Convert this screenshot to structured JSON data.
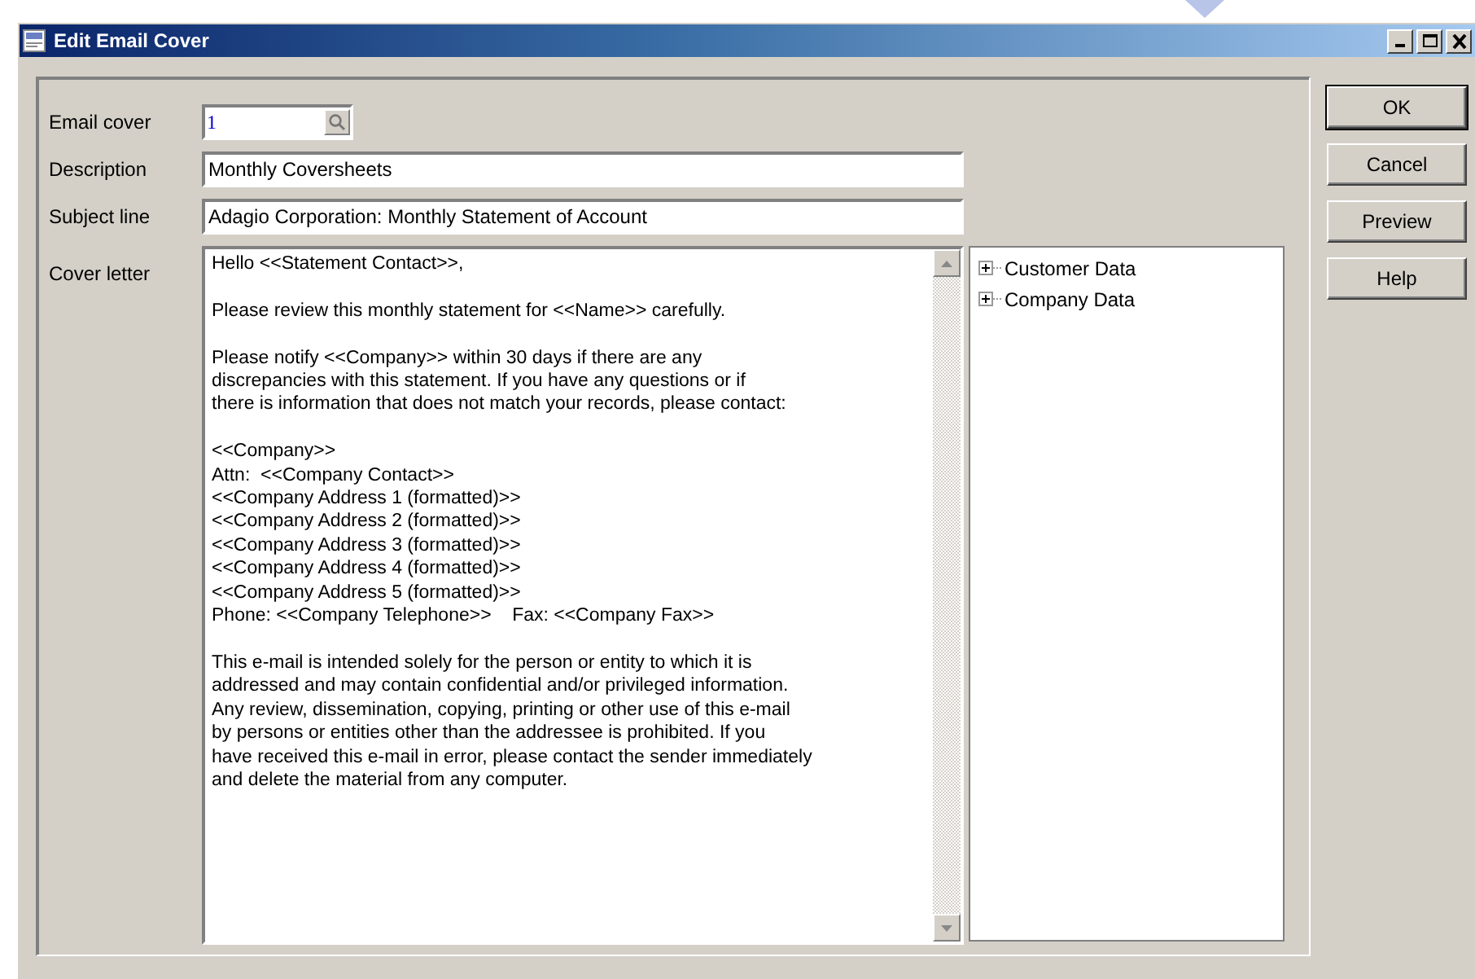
{
  "window": {
    "title": "Edit Email Cover"
  },
  "fields": [
    {
      "label": "Email cover",
      "value": "1",
      "kind": "lookup"
    },
    {
      "label": "Description",
      "value": "Monthly Coversheets",
      "kind": "text"
    },
    {
      "label": "Subject line",
      "value": "Adagio Corporation: Monthly Statement of Account",
      "kind": "text"
    }
  ],
  "cover_letter": {
    "label": "Cover letter",
    "value": "Hello <<Statement Contact>>,\n\nPlease review this monthly statement for <<Name>> carefully.\n\nPlease notify <<Company>> within 30 days if there are any\ndiscrepancies with this statement. If you have any questions or if\nthere is information that does not match your records, please contact:\n\n<<Company>>\nAttn:  <<Company Contact>>\n<<Company Address 1 (formatted)>>\n<<Company Address 2 (formatted)>>\n<<Company Address 3 (formatted)>>\n<<Company Address 4 (formatted)>>\n<<Company Address 5 (formatted)>>\nPhone: <<Company Telephone>>    Fax: <<Company Fax>>\n\nThis e-mail is intended solely for the person or entity to which it is\naddressed and may contain confidential and/or privileged information.\nAny review, dissemination, copying, printing or other use of this e-mail\nby persons or entities other than the addressee is prohibited. If you\nhave received this e-mail in error, please contact the sender immediately\nand delete the material from any computer."
  },
  "tree": [
    {
      "label": "Customer Data",
      "expanded": false
    },
    {
      "label": "Company Data",
      "expanded": false
    }
  ],
  "buttons": [
    "OK",
    "Cancel",
    "Preview",
    "Help"
  ]
}
